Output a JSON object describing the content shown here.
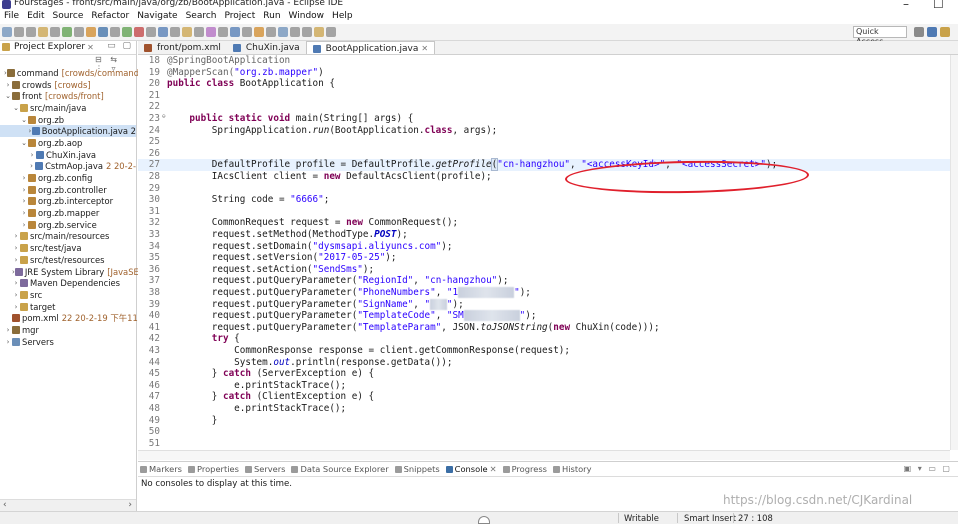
{
  "window": {
    "title": "Fourstages - front/src/main/java/org/zb/BootApplication.java - Eclipse IDE",
    "min_glyph": "–",
    "max_glyph": "☐"
  },
  "menu": [
    "File",
    "Edit",
    "Source",
    "Refactor",
    "Navigate",
    "Search",
    "Project",
    "Run",
    "Window",
    "Help"
  ],
  "toolbar": {
    "quick_access": "Quick Access"
  },
  "explorer": {
    "title": "Project Explorer",
    "close": "✕",
    "items": [
      {
        "label": "command",
        "deco": "[crowds/command]",
        "twisty": "›",
        "icon_color": "#8a6d3b"
      },
      {
        "label": "crowds",
        "deco": "[crowds]",
        "twisty": "›",
        "icon_color": "#8a6d3b"
      },
      {
        "label": "front",
        "deco": "[crowds/front]",
        "twisty": "⌄",
        "icon_color": "#8a6d3b"
      },
      {
        "label": "src/main/java",
        "deco": "",
        "twisty": "⌄",
        "icon_color": "#c9a24a"
      },
      {
        "label": "org.zb",
        "deco": "",
        "twisty": "⌄",
        "icon_color": "#b9863a"
      },
      {
        "label": "BootApplication.java 2",
        "deco": "",
        "twisty": "›",
        "icon_color": "#4f7ab3",
        "selected": true
      },
      {
        "label": "org.zb.aop",
        "deco": "",
        "twisty": "⌄",
        "icon_color": "#b9863a"
      },
      {
        "label": "ChuXin.java",
        "deco": "",
        "twisty": "›",
        "icon_color": "#4f7ab3"
      },
      {
        "label": "CstmAop.java",
        "deco": "2  20-2-",
        "twisty": "›",
        "icon_color": "#4f7ab3"
      },
      {
        "label": "org.zb.config",
        "deco": "",
        "twisty": "›",
        "icon_color": "#b9863a"
      },
      {
        "label": "org.zb.controller",
        "deco": "",
        "twisty": "›",
        "icon_color": "#b9863a"
      },
      {
        "label": "org.zb.interceptor",
        "deco": "",
        "twisty": "›",
        "icon_color": "#b9863a"
      },
      {
        "label": "org.zb.mapper",
        "deco": "",
        "twisty": "›",
        "icon_color": "#b9863a"
      },
      {
        "label": "org.zb.service",
        "deco": "",
        "twisty": "›",
        "icon_color": "#b9863a"
      },
      {
        "label": "src/main/resources",
        "deco": "",
        "twisty": "›",
        "icon_color": "#c9a24a"
      },
      {
        "label": "src/test/java",
        "deco": "",
        "twisty": "›",
        "icon_color": "#c9a24a"
      },
      {
        "label": "src/test/resources",
        "deco": "",
        "twisty": "›",
        "icon_color": "#c9a24a"
      },
      {
        "label": "JRE System Library",
        "deco": "[JavaSE-1",
        "twisty": "›",
        "icon_color": "#7d6a9c"
      },
      {
        "label": "Maven Dependencies",
        "deco": "",
        "twisty": "›",
        "icon_color": "#7d6a9c"
      },
      {
        "label": "src",
        "deco": "",
        "twisty": "›",
        "icon_color": "#c9a24a"
      },
      {
        "label": "target",
        "deco": "",
        "twisty": "›",
        "icon_color": "#c9a24a"
      },
      {
        "label": "pom.xml",
        "deco": "22  20-2-19 下午11",
        "twisty": "",
        "icon_color": "#a0522d"
      },
      {
        "label": "mgr",
        "deco": "",
        "twisty": "›",
        "icon_color": "#8a6d3b"
      },
      {
        "label": "Servers",
        "deco": "",
        "twisty": "›",
        "icon_color": "#6b8fb8"
      }
    ]
  },
  "editor": {
    "tabs": [
      {
        "label": "front/pom.xml",
        "active": false
      },
      {
        "label": "ChuXin.java",
        "active": false
      },
      {
        "label": "BootApplication.java",
        "active": true,
        "close": "✕"
      }
    ],
    "line_numbers": [
      "18",
      "19",
      "20",
      "21",
      "22",
      "23",
      "24",
      "25",
      "26",
      "27",
      "28",
      "29",
      "30",
      "31",
      "32",
      "33",
      "34",
      "35",
      "36",
      "37",
      "38",
      "39",
      "40",
      "41",
      "42",
      "43",
      "44",
      "45",
      "46",
      "47",
      "48",
      "49",
      "50",
      "51"
    ],
    "fold_markers": {
      "23": "⊖"
    },
    "code": {
      "l18": "@SpringBootApplication",
      "l19a": "@MapperScan(",
      "l19b": "\"org.zb.mapper\"",
      "l19c": ")",
      "l20a": "public class ",
      "l20b": "BootApplication {",
      "l23a": "    public static void ",
      "l23b": "main(String[] args) {",
      "l24a": "        SpringApplication.",
      "l24b": "run",
      "l24c": "(BootApplication.",
      "l24d": "class",
      "l24e": ", args);",
      "l27a": "        DefaultProfile profile = DefaultProfile.",
      "l27b": "getProfile",
      "l27c": "(",
      "l27d": "\"cn-hangzhou\"",
      "l27e": ", ",
      "l27f": "\"<accessKeyId>\"",
      "l27g": ", ",
      "l27h": "\"<accessSecret>\"",
      "l27i": ");",
      "l28a": "        IAcsClient client = ",
      "l28b": "new ",
      "l28c": "DefaultAcsClient(profile);",
      "l30a": "        String code = ",
      "l30b": "\"6666\"",
      "l30c": ";",
      "l32a": "        CommonRequest request = ",
      "l32b": "new ",
      "l32c": "CommonRequest();",
      "l33a": "        request.setMethod(MethodType.",
      "l33b": "POST",
      "l33c": ");",
      "l34a": "        request.setDomain(",
      "l34b": "\"dysmsapi.aliyuncs.com\"",
      "l34c": ");",
      "l35a": "        request.setVersion(",
      "l35b": "\"2017-05-25\"",
      "l35c": ");",
      "l36a": "        request.setAction(",
      "l36b": "\"SendSms\"",
      "l36c": ");",
      "l37a": "        request.putQueryParameter(",
      "l37b": "\"RegionId\"",
      "l37c": ", ",
      "l37d": "\"cn-hangzhou\"",
      "l37e": ");",
      "l38a": "        request.putQueryParameter(",
      "l38b": "\"PhoneNumbers\"",
      "l38c": ", ",
      "l38d": "\"1",
      "l38blur": "          ",
      "l38e": "\"",
      "l38f": ");",
      "l39a": "        request.putQueryParameter(",
      "l39b": "\"SignName\"",
      "l39c": ", ",
      "l39d": "\"",
      "l39blur": "   ",
      "l39e": "\"",
      "l39f": ");",
      "l40a": "        request.putQueryParameter(",
      "l40b": "\"TemplateCode\"",
      "l40c": ", ",
      "l40d": "\"SM",
      "l40blur": "          ",
      "l40e": "\"",
      "l40f": ");",
      "l41a": "        request.putQueryParameter(",
      "l41b": "\"TemplateParam\"",
      "l41c": ", JSON.",
      "l41d": "toJSONString",
      "l41e": "(",
      "l41f": "new ",
      "l41g": "ChuXin(code)));",
      "l42a": "        try ",
      "l42b": "{",
      "l43": "            CommonResponse response = client.getCommonResponse(request);",
      "l44a": "            System.",
      "l44b": "out",
      "l44c": ".println(response.getData());",
      "l45a": "        } ",
      "l45b": "catch ",
      "l45c": "(ServerException e) {",
      "l46": "            e.printStackTrace();",
      "l47a": "        } ",
      "l47b": "catch ",
      "l47c": "(ClientException e) {",
      "l48": "            e.printStackTrace();",
      "l49": "        }"
    }
  },
  "bottom": {
    "tabs": [
      {
        "label": "Markers",
        "icon_color": "#9b9b9b"
      },
      {
        "label": "Properties",
        "icon_color": "#9b9b9b"
      },
      {
        "label": "Servers",
        "icon_color": "#9b9b9b"
      },
      {
        "label": "Data Source Explorer",
        "icon_color": "#9b9b9b"
      },
      {
        "label": "Snippets",
        "icon_color": "#9b9b9b"
      },
      {
        "label": "Console",
        "icon_color": "#3b6ea5",
        "active": true,
        "close": "✕"
      },
      {
        "label": "Progress",
        "icon_color": "#9b9b9b"
      },
      {
        "label": "History",
        "icon_color": "#9b9b9b"
      }
    ],
    "console_message": "No consoles to display at this time."
  },
  "status": {
    "writable": "Writable",
    "insert_mode": "Smart Insert",
    "position": "27 : 108"
  },
  "watermark": "https://blog.csdn.net/CJKardinal",
  "colors": {
    "annotation_ring": "#e0202c",
    "keyword": "#7f0055",
    "string": "#2a00ff",
    "selection": "#cfe1f5"
  }
}
